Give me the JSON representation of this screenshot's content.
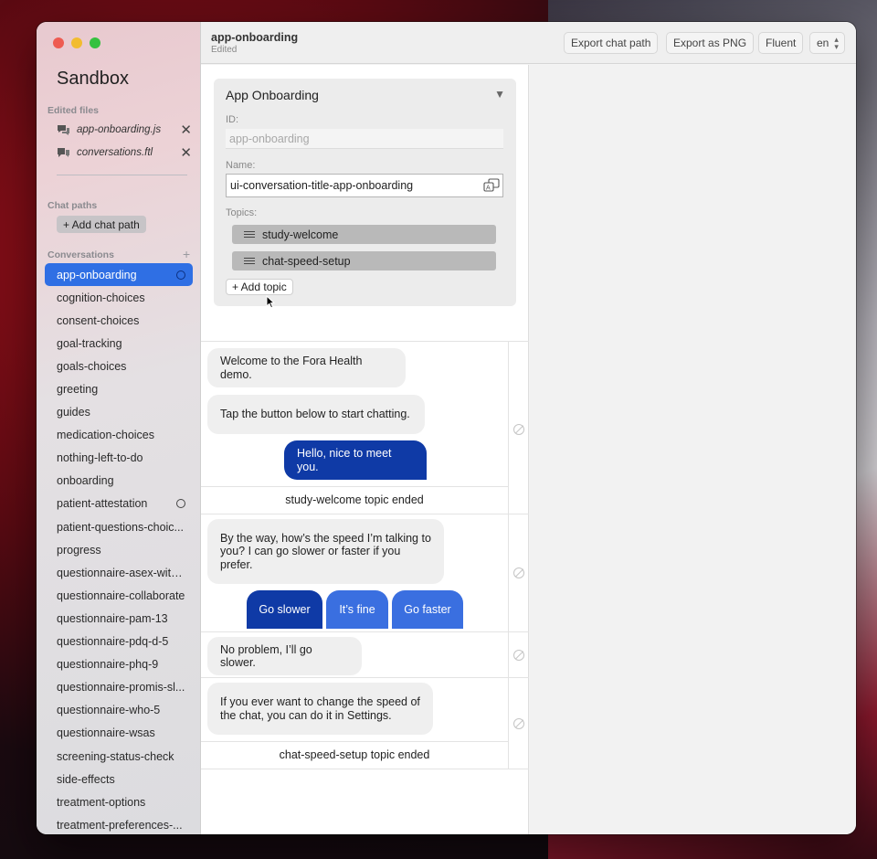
{
  "sidebar": {
    "app_title": "Sandbox",
    "edited_files_label": "Edited files",
    "edited_files": [
      {
        "name": "app-onboarding.js"
      },
      {
        "name": "conversations.ftl"
      }
    ],
    "chat_paths_label": "Chat paths",
    "add_chat_path": "+ Add chat path",
    "conversations_label": "Conversations",
    "conversations": [
      {
        "label": "app-onboarding",
        "active": true,
        "dot": true
      },
      {
        "label": "cognition-choices"
      },
      {
        "label": "consent-choices"
      },
      {
        "label": "goal-tracking"
      },
      {
        "label": "goals-choices"
      },
      {
        "label": "greeting"
      },
      {
        "label": "guides"
      },
      {
        "label": "medication-choices"
      },
      {
        "label": "nothing-left-to-do"
      },
      {
        "label": "onboarding"
      },
      {
        "label": "patient-attestation",
        "dot": true
      },
      {
        "label": "patient-questions-choic..."
      },
      {
        "label": "progress"
      },
      {
        "label": "questionnaire-asex-with..."
      },
      {
        "label": "questionnaire-collaborate"
      },
      {
        "label": "questionnaire-pam-13"
      },
      {
        "label": "questionnaire-pdq-d-5"
      },
      {
        "label": "questionnaire-phq-9"
      },
      {
        "label": "questionnaire-promis-sl..."
      },
      {
        "label": "questionnaire-who-5"
      },
      {
        "label": "questionnaire-wsas"
      },
      {
        "label": "screening-status-check"
      },
      {
        "label": "side-effects"
      },
      {
        "label": "treatment-options"
      },
      {
        "label": "treatment-preferences-..."
      }
    ]
  },
  "toolbar": {
    "title": "app-onboarding",
    "subtitle": "Edited",
    "export_chat_path": "Export chat path",
    "export_png": "Export as PNG",
    "fluent": "Fluent",
    "locale": "en"
  },
  "editor": {
    "title": "App Onboarding",
    "id_label": "ID:",
    "id_value": "app-onboarding",
    "name_label": "Name:",
    "name_value": "ui-conversation-title-app-onboarding",
    "topics_label": "Topics:",
    "topics": [
      "study-welcome",
      "chat-speed-setup"
    ],
    "add_topic": "+ Add topic"
  },
  "chat": {
    "msg1": "Welcome to the Fora Health demo.",
    "msg2": "Tap the button below to start chatting.",
    "reply1": "Hello, nice to meet you.",
    "ended1": "study-welcome topic ended",
    "msg3": "By the way, how’s the speed I’m talking to you? I can go slower or faster if you prefer.",
    "choices": [
      "Go slower",
      "It’s fine",
      "Go faster"
    ],
    "msg4": "No problem, I’ll go slower.",
    "msg5": "If you ever want to change the speed of the chat, you can do it in Settings.",
    "ended2": "chat-speed-setup topic ended"
  },
  "colors": {
    "accent": "#2f6fe4",
    "user_bubble": "#0f3aa6",
    "choice_selected": "#0f3aa6",
    "choice": "#3a6fe0"
  }
}
